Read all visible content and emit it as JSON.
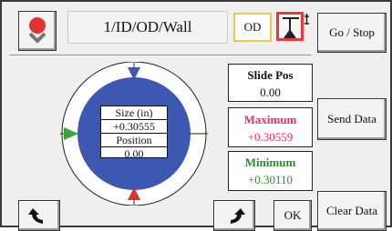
{
  "header": {
    "title": "1/ID/OD/Wall",
    "mode_label": "OD",
    "go_stop_label": "Go / Stop"
  },
  "gauge": {
    "size_label": "Size (in)",
    "size_value": "+0.30555",
    "position_label": "Position",
    "position_value": "0.00"
  },
  "slide_pos": {
    "label": "Slide Pos",
    "value": "0.00"
  },
  "maximum": {
    "label": "Maximum",
    "value": "+0.30559",
    "color": "#e0306e"
  },
  "minimum": {
    "label": "Minimum",
    "value": "+0.30110",
    "color": "#2e8b2e"
  },
  "buttons": {
    "send_data_label": "Send Data",
    "ok_label": "OK",
    "clear_data_label": "Clear Data"
  },
  "icons": {
    "status": "status-indicator-icon",
    "probe": "probe-icon",
    "back": "back-arrow-icon",
    "forward": "forward-arrow-icon"
  },
  "colors": {
    "gauge_fill": "#3d58b0",
    "marker_top": "#3d58b0",
    "marker_bottom": "#e03030",
    "marker_left": "#3aa53a",
    "status_red": "#e03232"
  }
}
